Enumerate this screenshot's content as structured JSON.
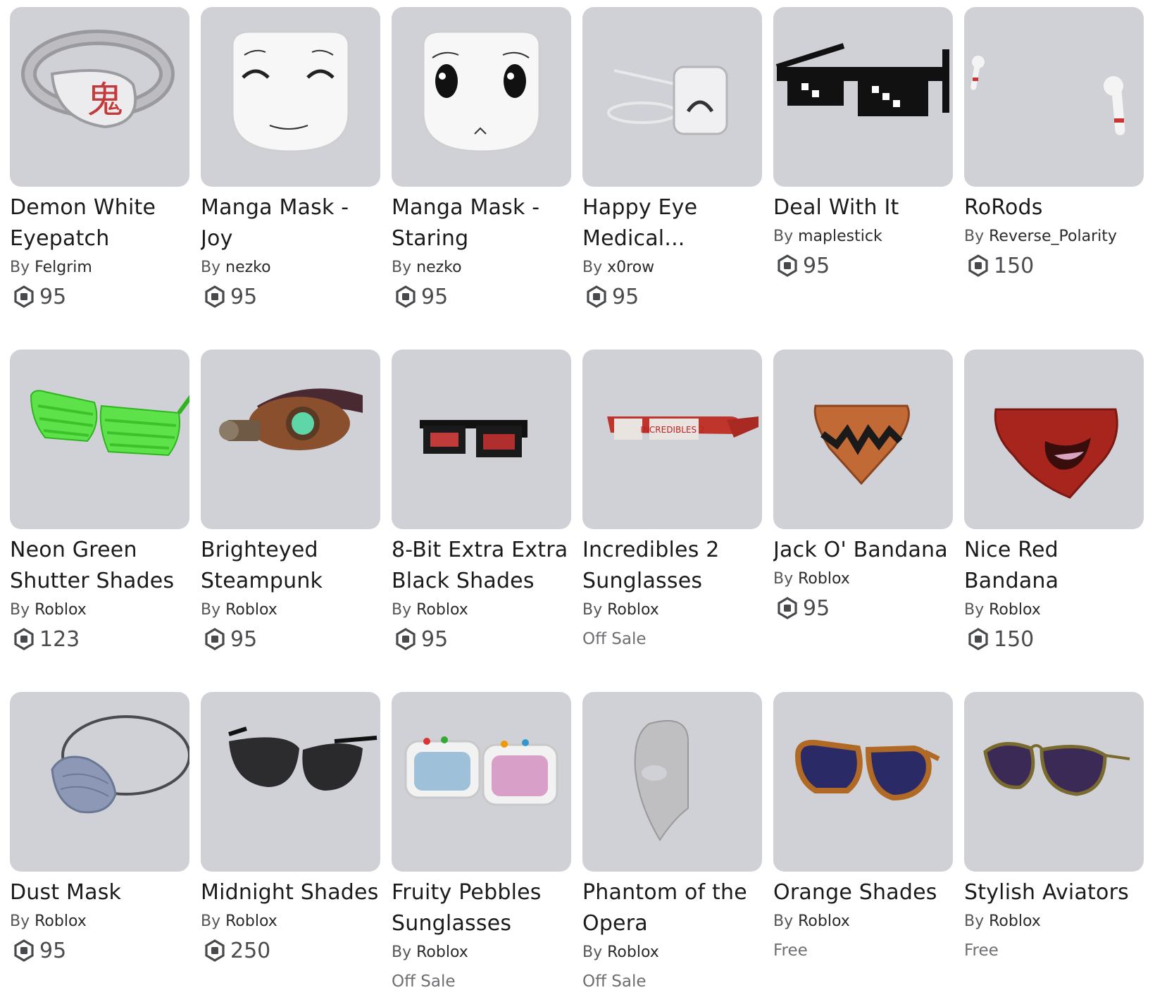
{
  "by_prefix": "By",
  "items": [
    {
      "name": "Demon White Eyepatch",
      "creator": "Felgrim",
      "price": "95",
      "icon": "eyepatch-icon"
    },
    {
      "name": "Manga Mask - Joy",
      "creator": "nezko",
      "price": "95",
      "icon": "mask-icon"
    },
    {
      "name": "Manga Mask - Staring",
      "creator": "nezko",
      "price": "95",
      "icon": "mask-icon"
    },
    {
      "name": "Happy Eye Medical...",
      "creator": "x0row",
      "price": "95",
      "icon": "medical-mask-icon"
    },
    {
      "name": "Deal With It",
      "creator": "maplestick",
      "price": "95",
      "icon": "pixel-glasses-icon"
    },
    {
      "name": "RoRods",
      "creator": "Reverse_Polarity",
      "price": "150",
      "icon": "earbuds-icon"
    },
    {
      "name": "Neon Green Shutter Shades",
      "creator": "Roblox",
      "price": "123",
      "icon": "shutter-shades-icon"
    },
    {
      "name": "Brighteyed Steampunk",
      "creator": "Roblox",
      "price": "95",
      "icon": "steampunk-goggle-icon"
    },
    {
      "name": "8-Bit Extra Extra Black Shades",
      "creator": "Roblox",
      "price": "95",
      "icon": "pixel-shades-icon"
    },
    {
      "name": "Incredibles 2 Sunglasses",
      "creator": "Roblox",
      "price": "Off Sale",
      "icon": "sunglasses-icon"
    },
    {
      "name": "Jack O' Bandana",
      "creator": "Roblox",
      "price": "95",
      "icon": "bandana-icon"
    },
    {
      "name": "Nice Red Bandana",
      "creator": "Roblox",
      "price": "150",
      "icon": "bandana-icon"
    },
    {
      "name": "Dust Mask",
      "creator": "Roblox",
      "price": "95",
      "icon": "dust-mask-icon"
    },
    {
      "name": "Midnight Shades",
      "creator": "Roblox",
      "price": "250",
      "icon": "aviator-icon"
    },
    {
      "name": "Fruity Pebbles Sunglasses",
      "creator": "Roblox",
      "price": "Off Sale",
      "icon": "sunglasses-icon"
    },
    {
      "name": "Phantom of the Opera",
      "creator": "Roblox",
      "price": "Off Sale",
      "icon": "half-mask-icon"
    },
    {
      "name": "Orange Shades",
      "creator": "Roblox",
      "price": "Free",
      "icon": "sunglasses-icon"
    },
    {
      "name": "Stylish Aviators",
      "creator": "Roblox",
      "price": "Free",
      "icon": "aviator-icon"
    }
  ]
}
